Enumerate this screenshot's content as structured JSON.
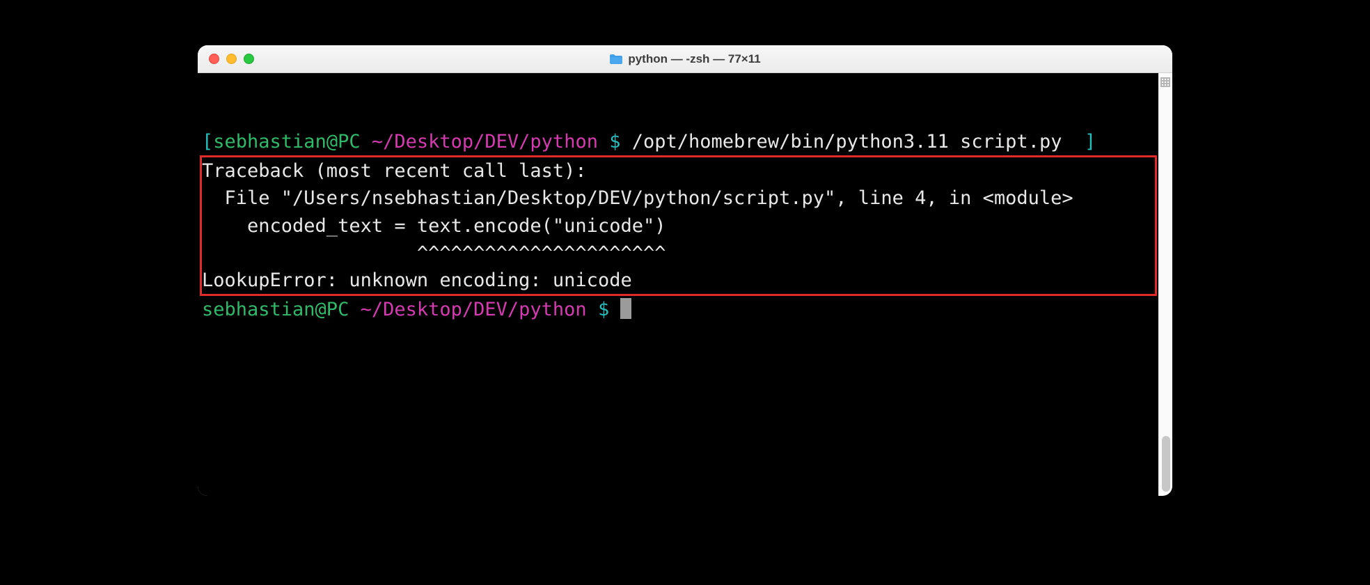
{
  "window": {
    "title": "python — -zsh — 77×11"
  },
  "prompt": {
    "open_bracket": "[",
    "close_bracket": "]",
    "user_host": "sebhastian@PC",
    "path": " ~/Desktop/DEV/python",
    "dollar": " $ ",
    "command": "/opt/homebrew/bin/python3.11 script.py"
  },
  "traceback": {
    "line1": "Traceback (most recent call last):",
    "line2": "  File \"/Users/nsebhastian/Desktop/DEV/python/script.py\", line 4, in <module>",
    "line3": "    encoded_text = text.encode(\"unicode\")",
    "line4": "                   ^^^^^^^^^^^^^^^^^^^^^^",
    "line5": "LookupError: unknown encoding: unicode"
  },
  "prompt2": {
    "user_host": "sebhastian@PC",
    "path": " ~/Desktop/DEV/python",
    "dollar": " $ "
  }
}
